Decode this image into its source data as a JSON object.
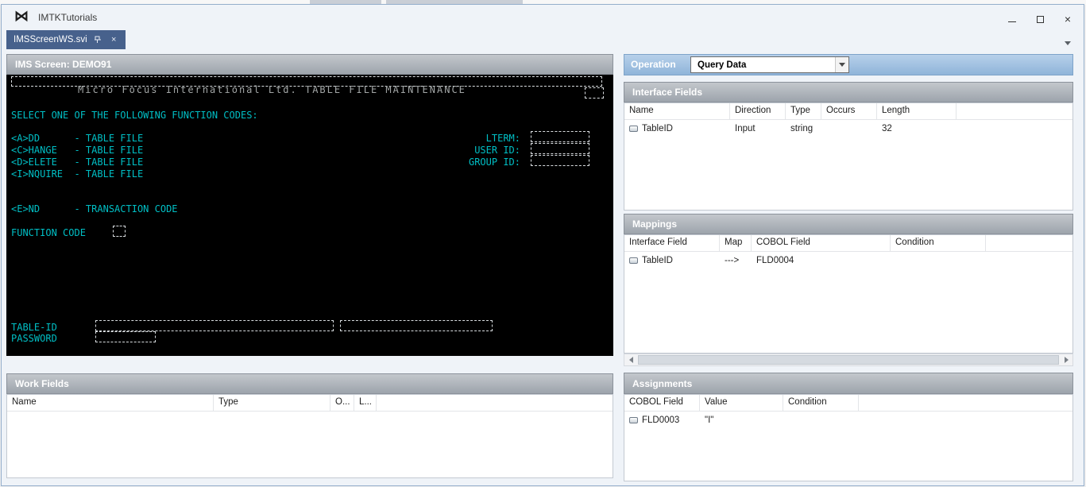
{
  "titlebar": {
    "app_title": "IMTKTutorials"
  },
  "tabs": {
    "active_label": "IMSScreenWS.svi"
  },
  "colors": {
    "tab_active": "#47618c",
    "terminal_text": "#00bfc5",
    "terminal_banner": "#a2a6a6",
    "operation_bar": "#9fbedd",
    "panel_header": "#a2a8b0"
  },
  "ims_screen": {
    "header": "IMS Screen: DEMO91",
    "banner": "Micro Focus International Ltd. TABLE FILE MAINTENANCE",
    "prompt": "SELECT ONE OF THE FOLLOWING FUNCTION CODES:",
    "option_add": "<A>DD      - TABLE FILE",
    "option_change": "<C>HANGE   - TABLE FILE",
    "option_delete": "<D>ELETE   - TABLE FILE",
    "option_inquire": "<I>NQUIRE  - TABLE FILE",
    "option_end": "<E>ND      - TRANSACTION CODE",
    "label_lterm": "LTERM:",
    "label_user_id": "USER ID:",
    "label_group_id": "GROUP ID:",
    "label_function_code": "FUNCTION CODE",
    "label_table_id": "TABLE-ID",
    "label_password": "PASSWORD"
  },
  "work_fields": {
    "header": "Work Fields",
    "columns": {
      "name": "Name",
      "type": "Type",
      "occurs": "O...",
      "length": "L..."
    }
  },
  "operation": {
    "label": "Operation",
    "selected": "Query Data"
  },
  "interface_fields": {
    "header": "Interface Fields",
    "columns": {
      "name": "Name",
      "direction": "Direction",
      "type": "Type",
      "occurs": "Occurs",
      "length": "Length"
    },
    "rows": [
      {
        "name": "TableID",
        "direction": "Input",
        "type": "string",
        "occurs": "",
        "length": "32"
      }
    ]
  },
  "mappings": {
    "header": "Mappings",
    "columns": {
      "interface_field": "Interface Field",
      "map": "Map",
      "cobol_field": "COBOL Field",
      "condition": "Condition"
    },
    "rows": [
      {
        "interface_field": "TableID",
        "map": "--->",
        "cobol_field": "FLD0004",
        "condition": ""
      }
    ]
  },
  "assignments": {
    "header": "Assignments",
    "columns": {
      "cobol_field": "COBOL Field",
      "value": "Value",
      "condition": "Condition"
    },
    "rows": [
      {
        "cobol_field": "FLD0003",
        "value": "\"I\"",
        "condition": ""
      }
    ]
  }
}
